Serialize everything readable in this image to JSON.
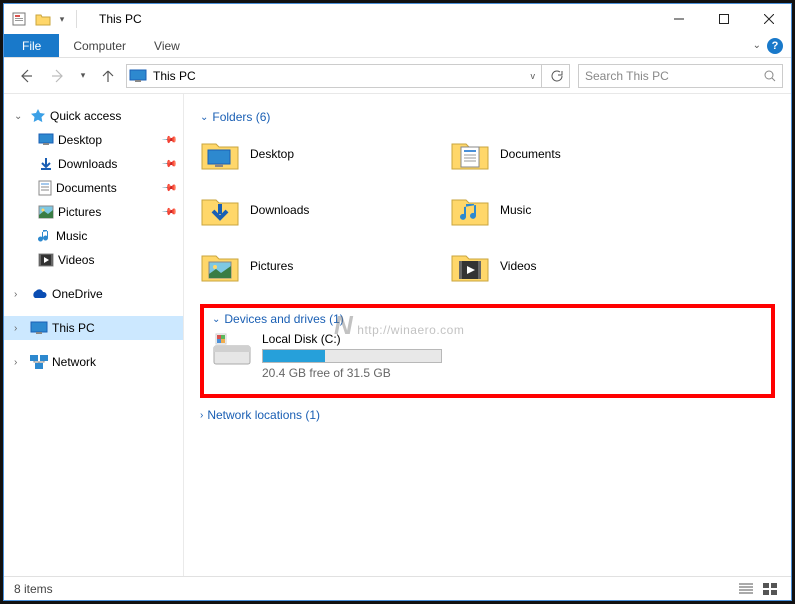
{
  "window": {
    "title": "This PC"
  },
  "ribbon": {
    "file": "File",
    "computer": "Computer",
    "view": "View"
  },
  "address": {
    "location": "This PC"
  },
  "search": {
    "placeholder": "Search This PC"
  },
  "navpane": {
    "quick_access": "Quick access",
    "items": [
      {
        "label": "Desktop"
      },
      {
        "label": "Downloads"
      },
      {
        "label": "Documents"
      },
      {
        "label": "Pictures"
      },
      {
        "label": "Music"
      },
      {
        "label": "Videos"
      }
    ],
    "onedrive": "OneDrive",
    "this_pc": "This PC",
    "network": "Network"
  },
  "groups": {
    "folders": {
      "header": "Folders (6)"
    },
    "drives": {
      "header": "Devices and drives (1)"
    },
    "network": {
      "header": "Network locations (1)"
    }
  },
  "folders": [
    {
      "label": "Desktop"
    },
    {
      "label": "Documents"
    },
    {
      "label": "Downloads"
    },
    {
      "label": "Music"
    },
    {
      "label": "Pictures"
    },
    {
      "label": "Videos"
    }
  ],
  "drive": {
    "name": "Local Disk (C:)",
    "free_text": "20.4 GB free of 31.5 GB",
    "used_pct": 35
  },
  "watermark": "http://winaero.com",
  "status": {
    "items": "8 items"
  }
}
